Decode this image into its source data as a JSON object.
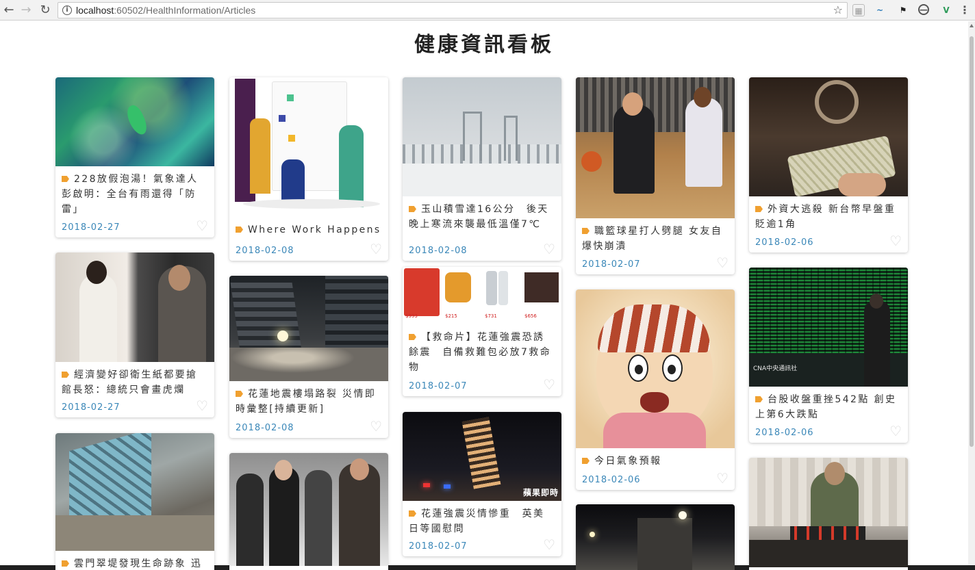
{
  "browser": {
    "url_host": "localhost",
    "url_path": ":60502/HealthInformation/Articles"
  },
  "page": {
    "title": "健康資訊看板"
  },
  "articles": [
    {
      "title": "228放假泡湯！氣象達人彭啟明：全台有雨還得「防雷」",
      "date": "2018-02-27"
    },
    {
      "title": "Where Work Happens",
      "date": "2018-02-08"
    },
    {
      "title": "玉山積雪達16公分　後天晚上寒流來襲最低溫僅7℃",
      "date": "2018-02-08"
    },
    {
      "title": "職籃球星打人劈腿 女友自爆快崩潰",
      "date": "2018-02-07"
    },
    {
      "title": "外資大逃殺 新台幣早盤重貶逾1角",
      "date": "2018-02-06"
    },
    {
      "title": "經濟變好卻衛生紙都要搶　館長怒：總統只會畫虎爛",
      "date": "2018-02-27"
    },
    {
      "title": "花蓮地震樓塌路裂 災情即時彙整[持續更新]",
      "date": "2018-02-08"
    },
    {
      "title": "【救命片】花蓮強震恐誘餘震　自備救難包必放7救命物",
      "date": "2018-02-07"
    },
    {
      "title": "今日氣象預報",
      "date": "2018-02-06"
    },
    {
      "title": "台股收盤重挫542點 創史上第6大跌點",
      "date": "2018-02-06"
    },
    {
      "title": "雲門翠堤發現生命跡象 迅",
      "date": ""
    },
    {
      "title": "花蓮強震災情慘重　英美日等國慰問",
      "date": "2018-02-07"
    },
    {
      "title": "",
      "date": ""
    },
    {
      "title": "",
      "date": ""
    },
    {
      "title": "",
      "date": ""
    }
  ],
  "image_texts": {
    "apple_daily": "蘋果即時",
    "cna": "CNA中央通訊社",
    "shop_prices": [
      "$993",
      "$215",
      "$731",
      "$656"
    ]
  },
  "colors": {
    "date": "#3a87b8",
    "tag": "#f0a030",
    "heart": "#d6d6d6"
  }
}
